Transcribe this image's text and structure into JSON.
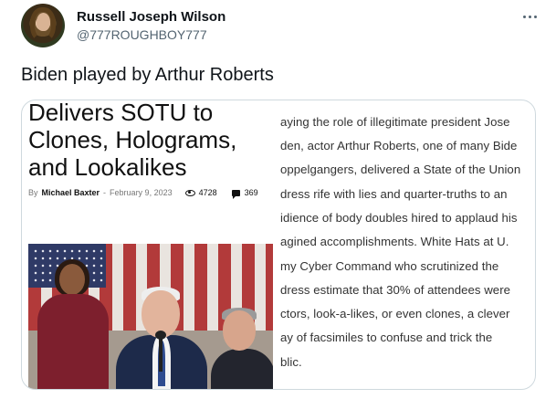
{
  "author": {
    "display_name": "Russell Joseph Wilson",
    "handle": "@777ROUGHBOY777"
  },
  "tweet": {
    "text": "Biden played by Arthur Roberts"
  },
  "card": {
    "headline": "Delivers SOTU to Clones, Holograms, and Lookalikes",
    "byline": {
      "by": "By",
      "author": "Michael Baxter",
      "separator": "-",
      "date": "February 9, 2023",
      "views": "4728",
      "comments": "369"
    },
    "photo_icon": "sotu-photo",
    "article_lines": [
      "aying the role of illegitimate president Jose",
      "den, actor Arthur Roberts, one of many Bide",
      "oppelgangers, delivered a State of the Union",
      "dress rife with lies and quarter-truths to an",
      "idience of body doubles hired to applaud his",
      "agined accomplishments. White Hats at U.",
      "my Cyber Command who scrutinized the",
      "dress estimate that 30% of attendees were",
      "ctors, look-a-likes, or even clones, a clever",
      "ay of facsimiles to confuse and trick the",
      "blic."
    ]
  },
  "icons": {
    "more": "more-horizontal-icon",
    "views": "eye-icon",
    "comments": "comment-icon"
  }
}
